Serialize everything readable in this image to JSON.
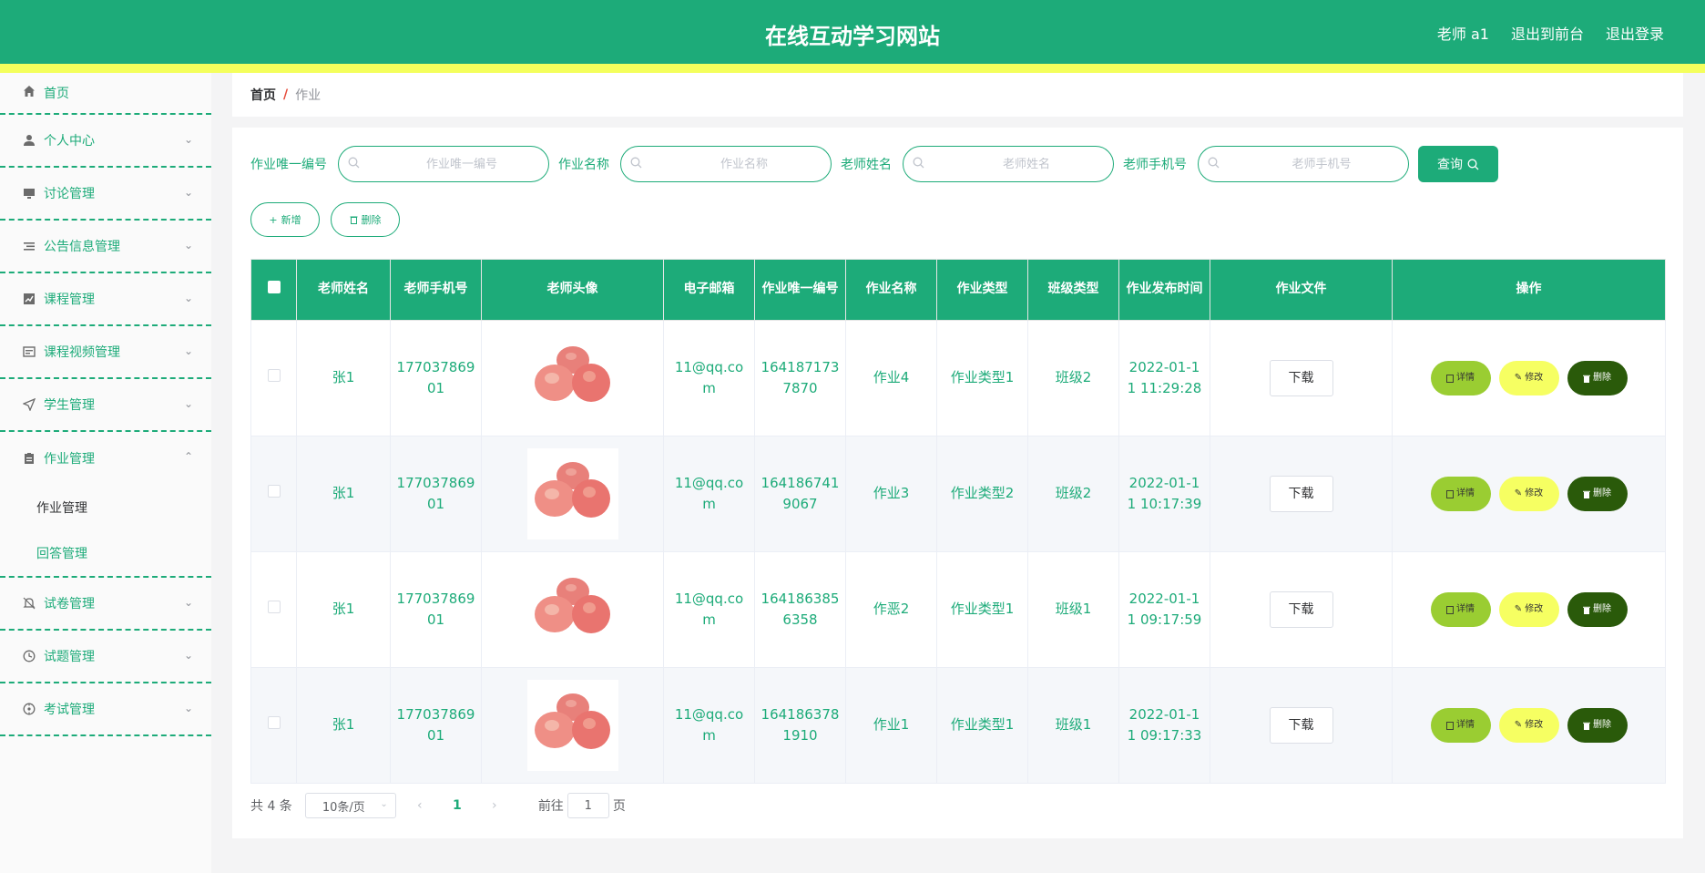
{
  "header": {
    "title": "在线互动学习网站",
    "user": "老师 a1",
    "to_front": "退出到前台",
    "logout": "退出登录"
  },
  "sidebar": {
    "items": [
      {
        "label": "首页",
        "icon": "home-icon"
      },
      {
        "label": "个人中心",
        "icon": "user-icon"
      },
      {
        "label": "讨论管理",
        "icon": "monitor-icon"
      },
      {
        "label": "公告信息管理",
        "icon": "list-icon"
      },
      {
        "label": "课程管理",
        "icon": "chart-icon"
      },
      {
        "label": "课程视频管理",
        "icon": "video-icon"
      },
      {
        "label": "学生管理",
        "icon": "send-icon"
      },
      {
        "label": "作业管理",
        "icon": "clipboard-icon"
      },
      {
        "label": "试卷管理",
        "icon": "bell-icon"
      },
      {
        "label": "试题管理",
        "icon": "clock-icon"
      },
      {
        "label": "考试管理",
        "icon": "target-icon"
      }
    ],
    "submenu": [
      "作业管理",
      "回答管理"
    ]
  },
  "breadcrumb": {
    "home": "首页",
    "sep": "/",
    "current": "作业"
  },
  "search": {
    "fields": [
      {
        "label": "作业唯一编号",
        "placeholder": "作业唯一编号"
      },
      {
        "label": "作业名称",
        "placeholder": "作业名称"
      },
      {
        "label": "老师姓名",
        "placeholder": "老师姓名"
      },
      {
        "label": "老师手机号",
        "placeholder": "老师手机号"
      }
    ],
    "button": "查询"
  },
  "actions": {
    "add": "新增",
    "delete": "删除"
  },
  "table": {
    "headers": [
      "老师姓名",
      "老师手机号",
      "老师头像",
      "电子邮箱",
      "作业唯一编号",
      "作业名称",
      "作业类型",
      "班级类型",
      "作业发布时间",
      "作业文件",
      "操作"
    ],
    "rows": [
      {
        "name": "张1",
        "phone": "17703786901",
        "email": "11@qq.com",
        "code": "1641871737870",
        "title": "作业4",
        "type": "作业类型1",
        "class": "班级2",
        "time": "2022-01-11 11:29:28"
      },
      {
        "name": "张1",
        "phone": "17703786901",
        "email": "11@qq.com",
        "code": "1641867419067",
        "title": "作业3",
        "type": "作业类型2",
        "class": "班级2",
        "time": "2022-01-11 10:17:39"
      },
      {
        "name": "张1",
        "phone": "17703786901",
        "email": "11@qq.com",
        "code": "1641863856358",
        "title": "作恶2",
        "type": "作业类型1",
        "class": "班级1",
        "time": "2022-01-11 09:17:59"
      },
      {
        "name": "张1",
        "phone": "17703786901",
        "email": "11@qq.com",
        "code": "1641863781910",
        "title": "作业1",
        "type": "作业类型1",
        "class": "班级1",
        "time": "2022-01-11 09:17:33"
      }
    ],
    "download": "下载",
    "detail": "详情",
    "edit": "修改",
    "remove": "删除"
  },
  "pagination": {
    "total": "共 4 条",
    "page_size": "10条/页",
    "current": "1",
    "goto_prefix": "前往",
    "goto_value": "1",
    "goto_suffix": "页"
  },
  "colors": {
    "primary": "#1dab79",
    "stripe": "#f4ff5c",
    "detail": "#9acd32",
    "edit": "#f6ff62",
    "delete": "#2a5a0a"
  }
}
